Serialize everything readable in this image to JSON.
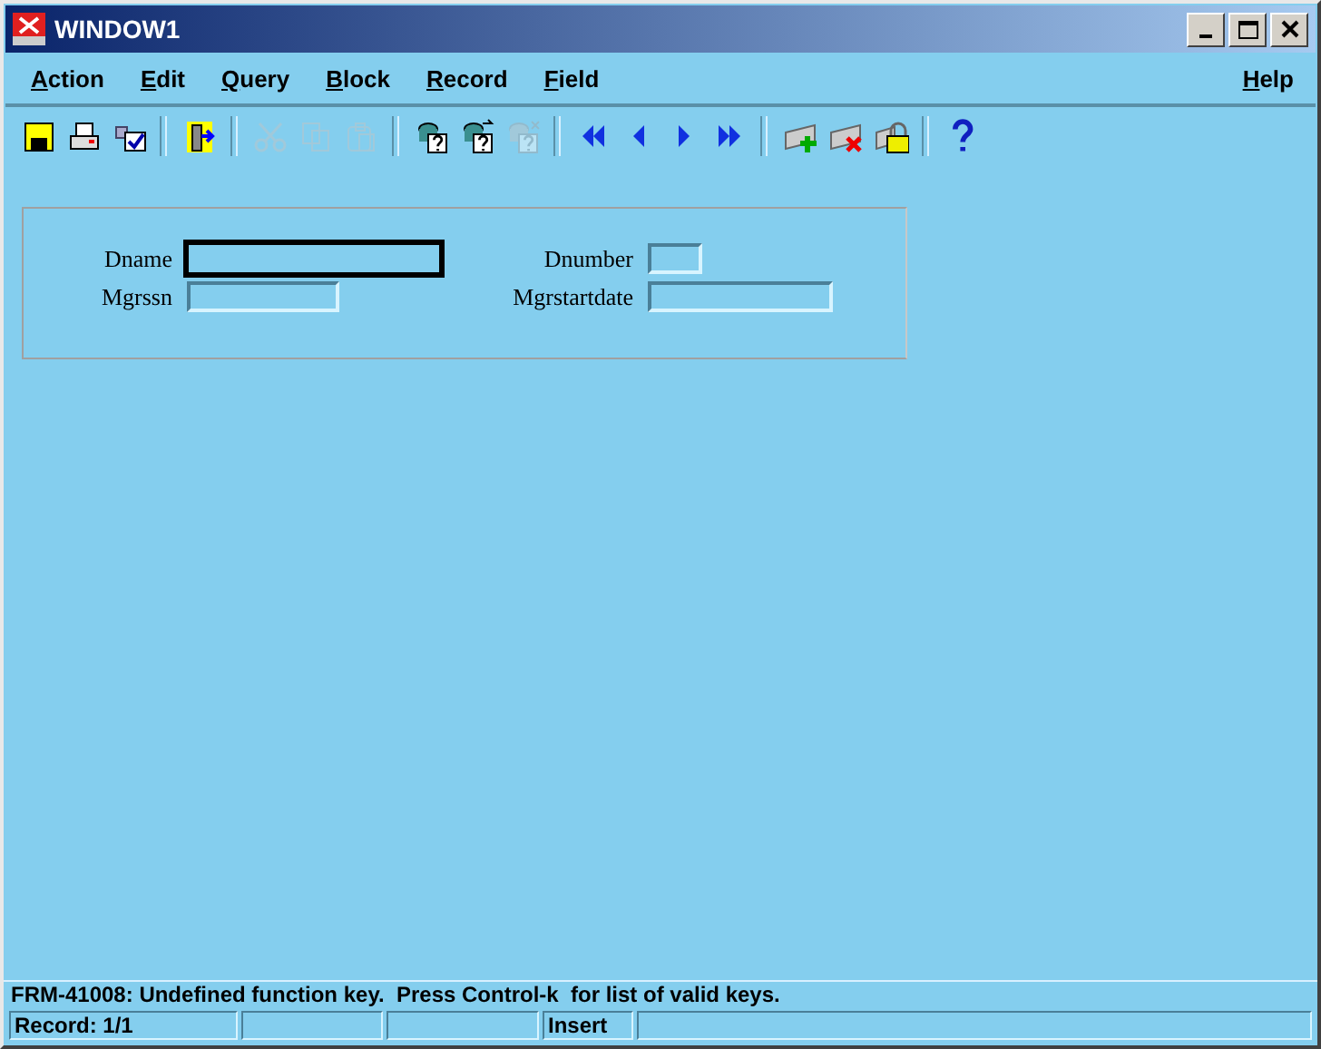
{
  "window": {
    "title": "WINDOW1"
  },
  "menu": {
    "items": [
      {
        "label": "Action"
      },
      {
        "label": "Edit"
      },
      {
        "label": "Query"
      },
      {
        "label": "Block"
      },
      {
        "label": "Record"
      },
      {
        "label": "Field"
      }
    ],
    "help": {
      "label": "Help"
    }
  },
  "toolbar": {
    "groups": [
      [
        {
          "kind": "save",
          "disabled": false
        },
        {
          "kind": "print",
          "disabled": false
        },
        {
          "kind": "commit",
          "disabled": false
        }
      ],
      [
        {
          "kind": "exit",
          "disabled": false
        }
      ],
      [
        {
          "kind": "cut",
          "disabled": true
        },
        {
          "kind": "copy",
          "disabled": true
        },
        {
          "kind": "paste",
          "disabled": true
        }
      ],
      [
        {
          "kind": "enterquery",
          "disabled": false
        },
        {
          "kind": "executequery",
          "disabled": false
        },
        {
          "kind": "cancelquery",
          "disabled": true
        }
      ],
      [
        {
          "kind": "first",
          "disabled": false
        },
        {
          "kind": "previous",
          "disabled": false
        },
        {
          "kind": "next",
          "disabled": false
        },
        {
          "kind": "last",
          "disabled": false
        }
      ],
      [
        {
          "kind": "insert",
          "disabled": false
        },
        {
          "kind": "delete",
          "disabled": false
        },
        {
          "kind": "lock",
          "disabled": false
        }
      ],
      [
        {
          "kind": "help",
          "disabled": false
        }
      ]
    ]
  },
  "form": {
    "fields": [
      {
        "label": "Dname",
        "focused": true
      },
      {
        "label": "Dnumber",
        "focused": false
      },
      {
        "label": "Mgrssn",
        "focused": false
      },
      {
        "label": "Mgrstartdate",
        "focused": false
      }
    ]
  },
  "message": "FRM-41008: Undefined function key.  Press Control-k  for list of valid keys.",
  "status_bar": {
    "cells": [
      {
        "text": "Record: 1/1"
      },
      {},
      {},
      {
        "text": "Insert"
      },
      {}
    ]
  }
}
